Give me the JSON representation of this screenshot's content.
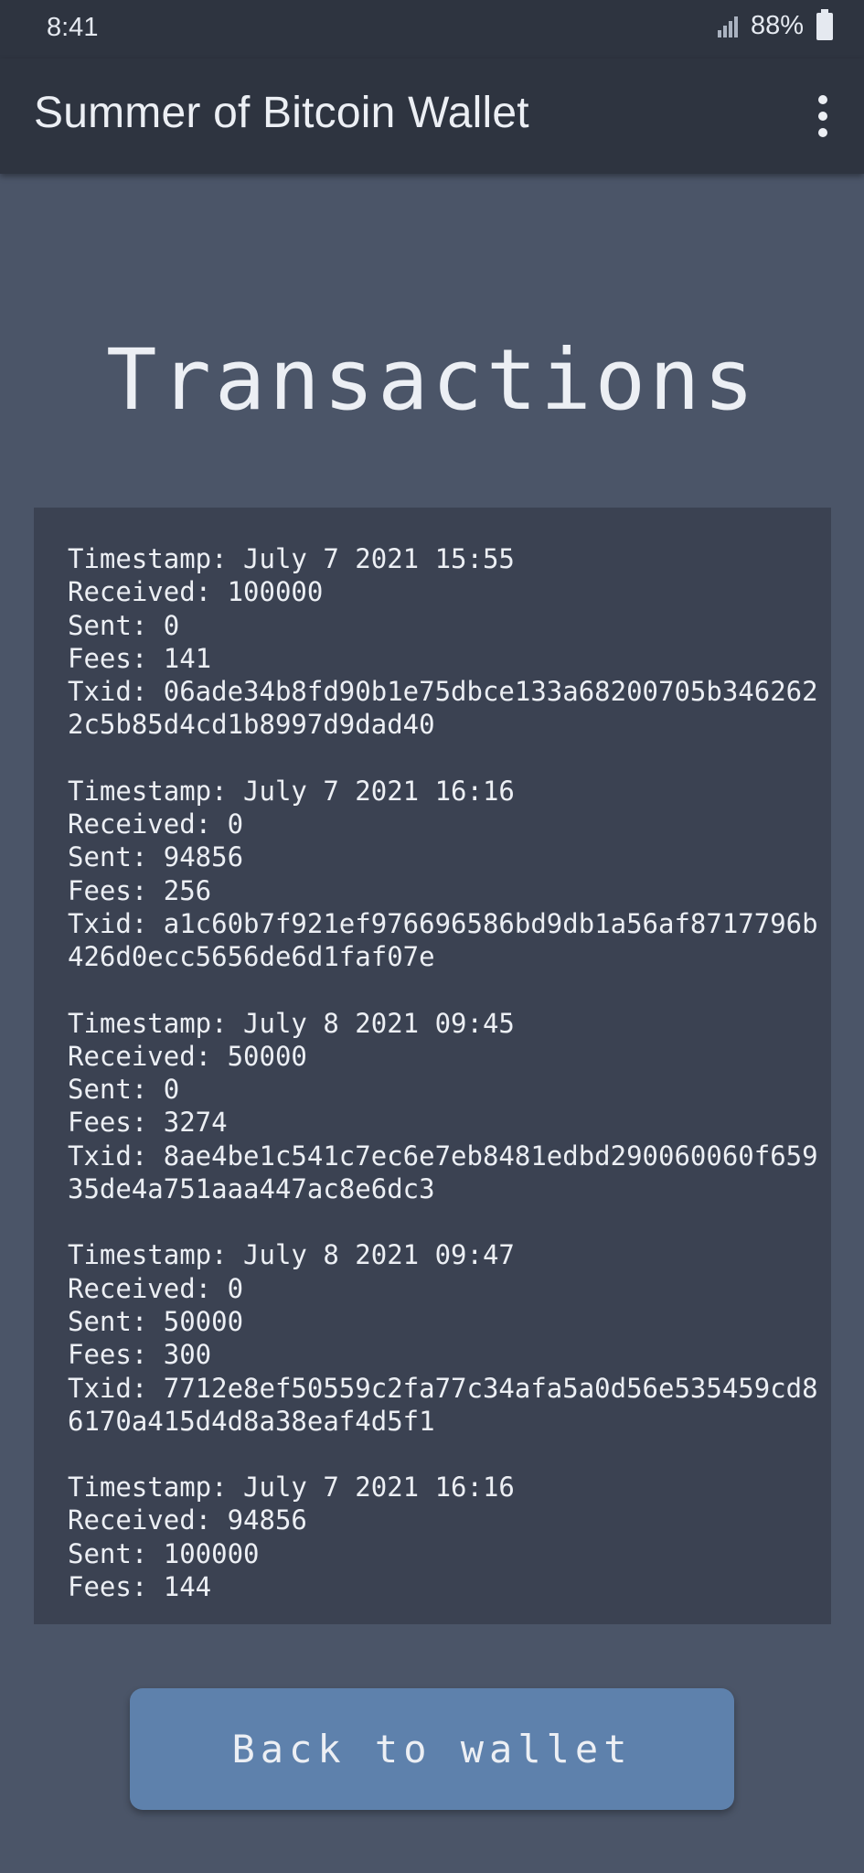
{
  "status_bar": {
    "time": "8:41",
    "battery": "88%"
  },
  "app_bar": {
    "title": "Summer of Bitcoin Wallet",
    "menu_icon": "more-vert-icon"
  },
  "page": {
    "heading": "Transactions"
  },
  "transactions": [
    {
      "timestamp": "Timestamp: July 7 2021 15:55",
      "received": "Received: 100000",
      "sent": "Sent: 0",
      "fees": "Fees: 141",
      "txid": "Txid: 06ade34b8fd90b1e75dbce133a68200705b3462622c5b85d4cd1b8997d9dad40"
    },
    {
      "timestamp": "Timestamp: July 7 2021 16:16",
      "received": "Received: 0",
      "sent": "Sent: 94856",
      "fees": "Fees: 256",
      "txid": "Txid: a1c60b7f921ef976696586bd9db1a56af8717796b426d0ecc5656de6d1faf07e"
    },
    {
      "timestamp": "Timestamp: July 8 2021 09:45",
      "received": "Received: 50000",
      "sent": "Sent: 0",
      "fees": "Fees: 3274",
      "txid": "Txid: 8ae4be1c541c7ec6e7eb8481edbd290060060f65935de4a751aaa447ac8e6dc3"
    },
    {
      "timestamp": "Timestamp: July 8 2021 09:47",
      "received": "Received: 0",
      "sent": "Sent: 50000",
      "fees": "Fees: 300",
      "txid": "Txid: 7712e8ef50559c2fa77c34afa5a0d56e535459cd86170a415d4d8a38eaf4d5f1"
    },
    {
      "timestamp": "Timestamp: July 7 2021 16:16",
      "received": "Received: 94856",
      "sent": "Sent: 100000",
      "fees": "Fees: 144",
      "txid": ""
    }
  ],
  "actions": {
    "back_label": "Back to wallet"
  },
  "colors": {
    "background": "#4b5568",
    "app_bar": "#2e3440",
    "panel": "#3b4252",
    "button": "#5e81ac",
    "text": "#eceff4"
  }
}
